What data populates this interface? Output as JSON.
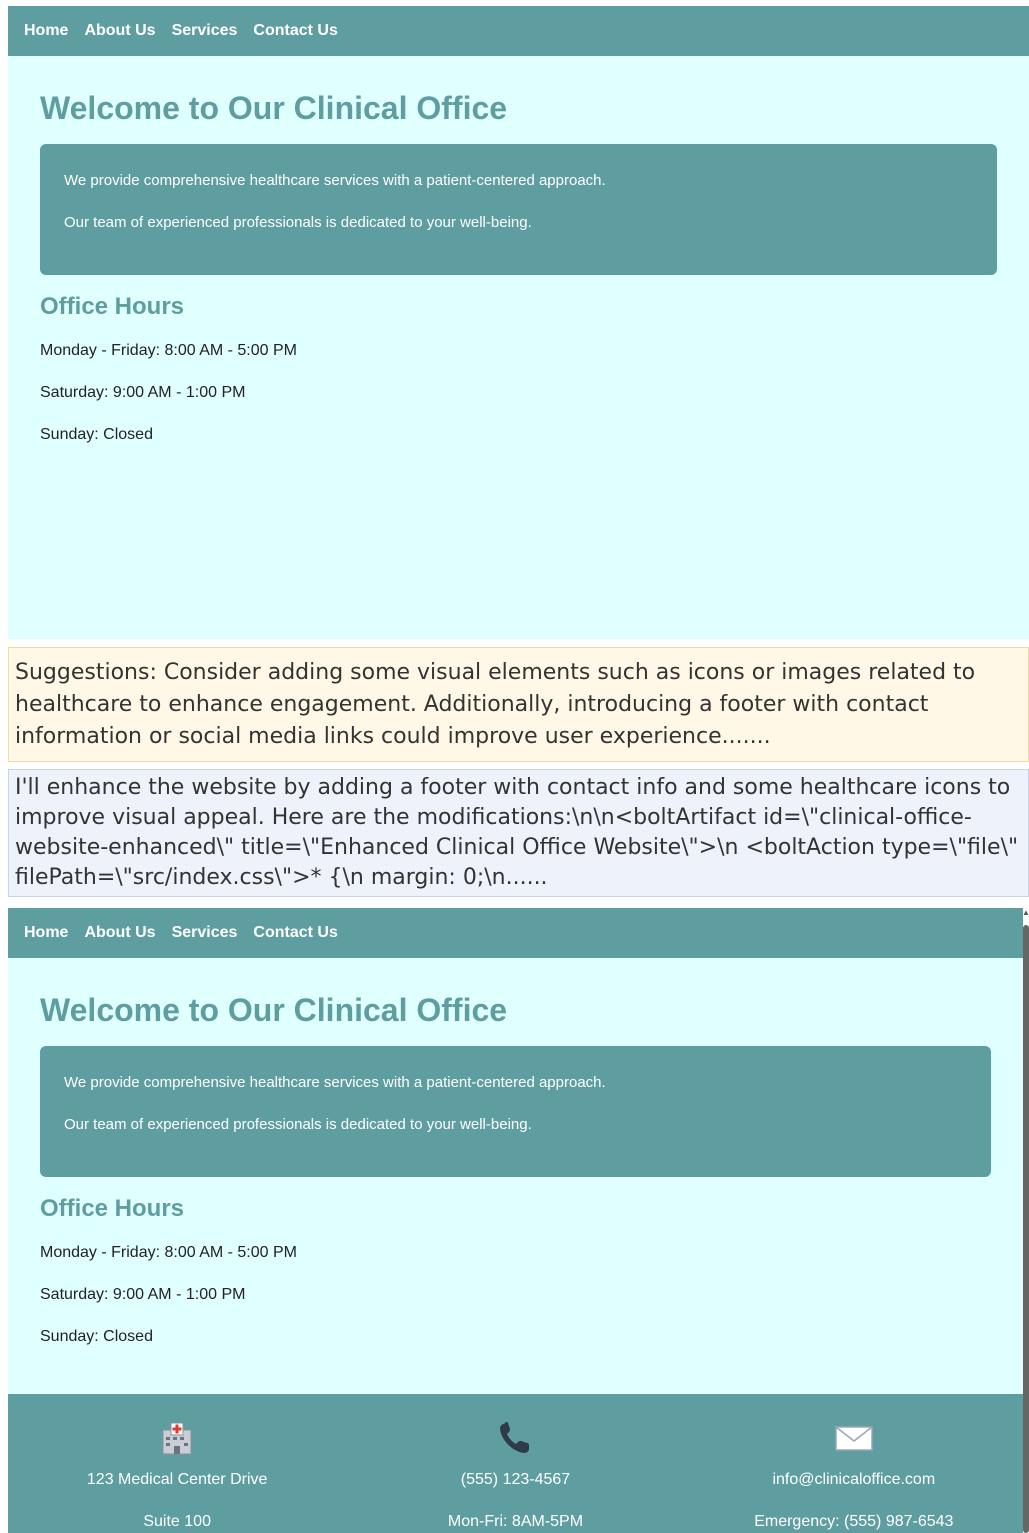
{
  "nav": {
    "items": [
      "Home",
      "About Us",
      "Services",
      "Contact Us"
    ]
  },
  "page": {
    "title": "Welcome to Our Clinical Office",
    "intro_1": "We provide comprehensive healthcare services with a patient-centered approach.",
    "intro_2": "Our team of experienced professionals is dedicated to your well-being.",
    "hours_title": "Office Hours",
    "hours": [
      "Monday - Friday: 8:00 AM - 5:00 PM",
      "Saturday: 9:00 AM - 1:00 PM",
      "Sunday: Closed"
    ]
  },
  "suggestion": {
    "text": "Suggestions: Consider adding some visual elements such as icons or images related to healthcare to enhance engagement. Additionally, introducing a footer with contact information or social media links could improve user experience......."
  },
  "response": {
    "text": "I'll enhance the website by adding a footer with contact info and some healthcare icons to improve visual appeal. Here are the modifications:\\n\\n<boltArtifact id=\\\"clinical-office-website-enhanced\\\" title=\\\"Enhanced Clinical Office Website\\\">\\n  <boltAction type=\\\"file\\\" filePath=\\\"src/index.css\\\">* {\\n  margin: 0;\\n......"
  },
  "footer": {
    "columns": [
      {
        "icon": "hospital-icon",
        "line1": "123 Medical Center Drive",
        "line2": "Suite 100"
      },
      {
        "icon": "phone-icon",
        "line1": "(555) 123-4567",
        "line2": "Mon-Fri: 8AM-5PM"
      },
      {
        "icon": "envelope-icon",
        "line1": "info@clinicaloffice.com",
        "line2": "Emergency: (555) 987-6543"
      }
    ]
  },
  "colors": {
    "teal": "#5f9ea0",
    "background": "#e0ffff",
    "suggestion_bg": "#fff8e6",
    "response_bg": "#eef2fb"
  }
}
